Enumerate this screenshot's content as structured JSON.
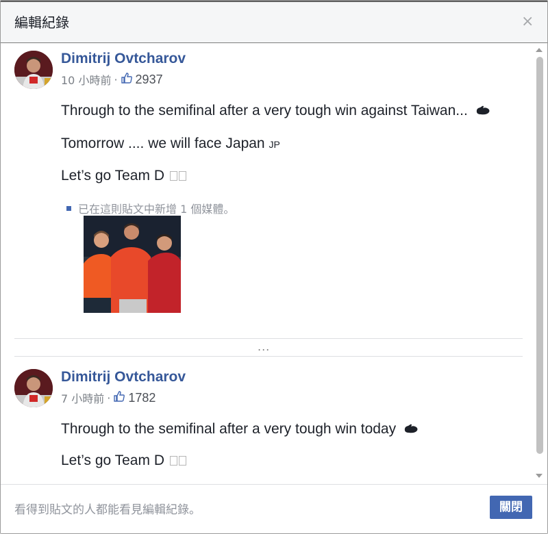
{
  "dialog": {
    "title": "編輯紀錄",
    "close_glyph": "×",
    "footer_note": "看得到貼文的人都能看見編輯紀錄。",
    "close_button_label": "關閉",
    "ellipsis": "..."
  },
  "posts": [
    {
      "author": "Dimitrij Ovtcharov",
      "time": "10 小時前",
      "separator": "·",
      "likes": "2937",
      "lines": [
        "Through to the semifinal after a very tough win against Taiwan...",
        "Tomorrow .... we will face Japan",
        "Let’s go Team D"
      ],
      "country_code": "JP",
      "media_note": "已在這則貼文中新增 1 個媒體。"
    },
    {
      "author": "Dimitrij Ovtcharov",
      "time": "7 小時前",
      "separator": "·",
      "likes": "1782",
      "lines": [
        "Through to the semifinal after a very tough win today",
        "Let’s go Team D"
      ]
    }
  ],
  "icons": {
    "like": "thumbs-up-icon",
    "flex": "flexed-biceps-icon",
    "close": "close-icon"
  },
  "colors": {
    "author_link": "#365899",
    "primary_button": "#4267b2",
    "muted_text": "#90949c"
  }
}
